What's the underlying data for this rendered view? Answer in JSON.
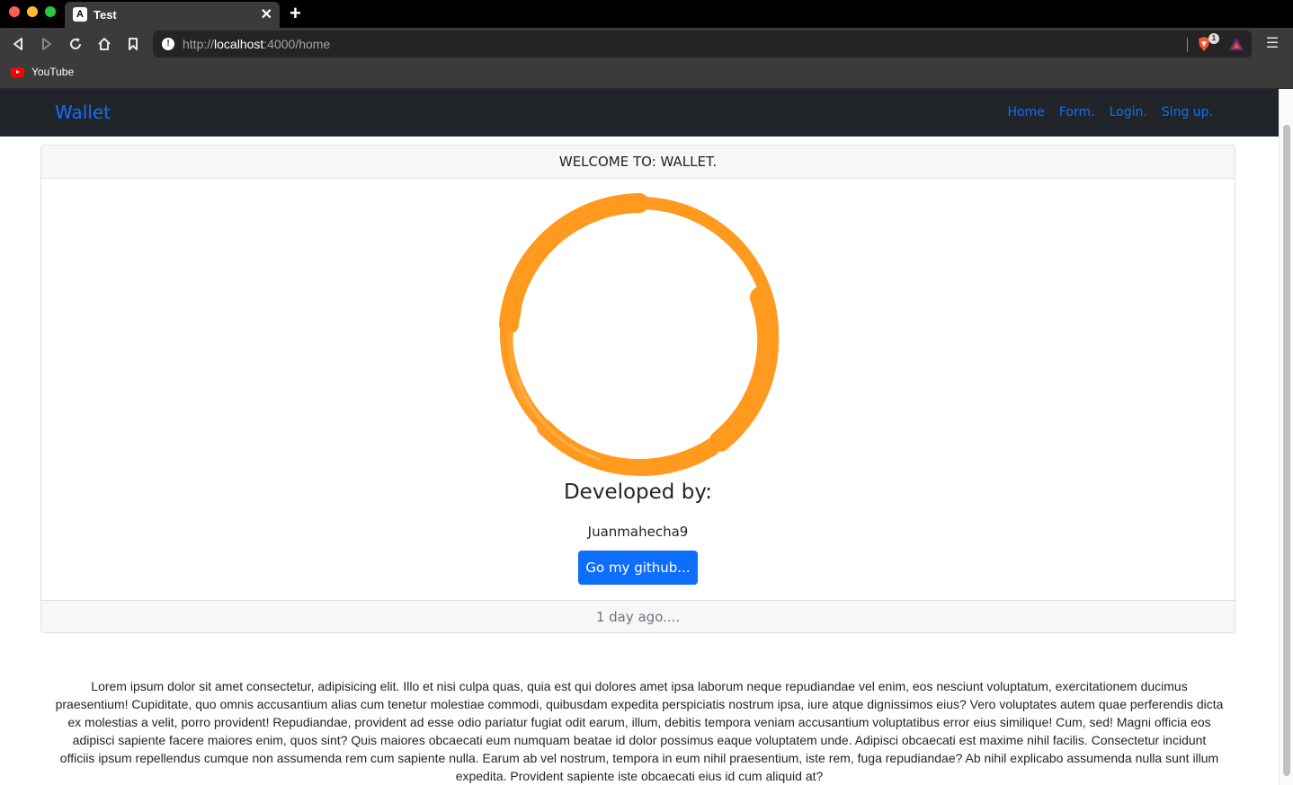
{
  "browser": {
    "tab_title": "Test",
    "tab_favicon": "A",
    "url_host": "localhost",
    "url_prefix": "http://",
    "url_suffix": ":4000/home",
    "brave_badge": "1",
    "bookmarks": [
      {
        "label": "YouTube",
        "icon": "youtube-icon"
      }
    ]
  },
  "navbar": {
    "brand": "Wallet",
    "links": [
      "Home",
      "Form.",
      "Login.",
      "Sing up."
    ]
  },
  "card": {
    "header": "WELCOME TO: WALLET.",
    "developed_by": "Developed by:",
    "developer_name": "Juanmahecha9",
    "button_label": "Go my github...",
    "footer": "1 day ago...."
  },
  "lorem": "Lorem ipsum dolor sit amet consectetur, adipisicing elit. Illo et nisi culpa quas, quia est qui dolores amet ipsa laborum neque repudiandae vel enim, eos nesciunt voluptatum, exercitationem ducimus praesentium! Cupiditate, quo omnis accusantium alias cum tenetur molestiae commodi, quibusdam expedita perspiciatis nostrum ipsa, iure atque dignissimos eius? Vero voluptates autem quae perferendis dicta ex molestias a velit, porro provident! Repudiandae, provident ad esse odio pariatur fugiat odit earum, illum, debitis tempora veniam accusantium voluptatibus error eius similique! Cum, sed! Magni officia eos adipisci sapiente facere maiores enim, quos sint? Quis maiores obcaecati eum numquam beatae id dolor possimus eaque voluptatem unde. Adipisci obcaecati est maxime nihil facilis. Consectetur incidunt officiis ipsum repellendus cumque non assumenda rem cum sapiente nulla. Earum ab vel nostrum, tempora in eum nihil praesentium, iste rem, fuga repudiandae? Ab nihil explicabo assumenda nulla sunt illum expedita. Provident sapiente iste obcaecati eius id cum aliquid at?",
  "colors": {
    "accent": "#0d6efd",
    "navbar_bg": "#212529",
    "ring": "#ff9a1f"
  }
}
